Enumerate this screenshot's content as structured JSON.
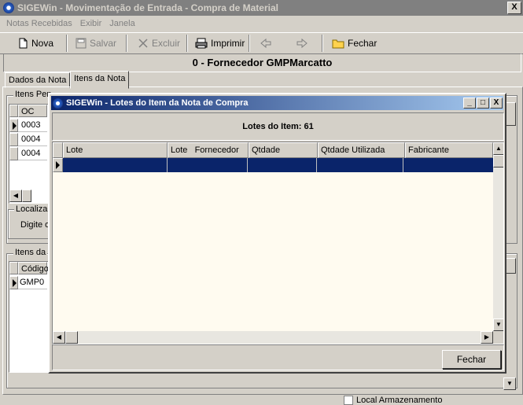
{
  "window": {
    "title": "SIGEWin - Movimentação de Entrada - Compra de Material",
    "close_glyph": "X"
  },
  "menu": [
    "Notas Recebidas",
    "Exibir",
    "Janela"
  ],
  "toolbar": {
    "nova": "Nova",
    "salvar": "Salvar",
    "excluir": "Excluir",
    "imprimir": "Imprimir",
    "fechar": "Fechar"
  },
  "header": {
    "title": "0 - Fornecedor GMPMarcatto"
  },
  "tabs": [
    "Dados da Nota",
    "Itens da Nota"
  ],
  "itens_pendentes": {
    "title": "Itens Pen",
    "col_oc": "OC",
    "rows": [
      "0003",
      "0004",
      "0004"
    ]
  },
  "localizar": {
    "title": "Localiza",
    "label": "Digite o"
  },
  "itens_da_nota": {
    "title": "Itens da",
    "col_codigo": "Código",
    "rows": [
      "GMP0"
    ]
  },
  "bottom": {
    "label": "Local Armazenamento"
  },
  "modal": {
    "title": "SIGEWin - Lotes do Item da Nota de Compra",
    "heading": "Lotes do Item: 61",
    "columns": [
      "Lote",
      "Lote   Fornecedor",
      "Qtdade",
      "Qtdade Utilizada",
      "Fabricante"
    ],
    "close_button": "Fechar",
    "win_min": "_",
    "win_max": "□",
    "win_close": "X"
  },
  "colors": {
    "grid_bg": "#fffbf0",
    "selected_row": "#0a246a",
    "title_active": "#0a246a"
  }
}
